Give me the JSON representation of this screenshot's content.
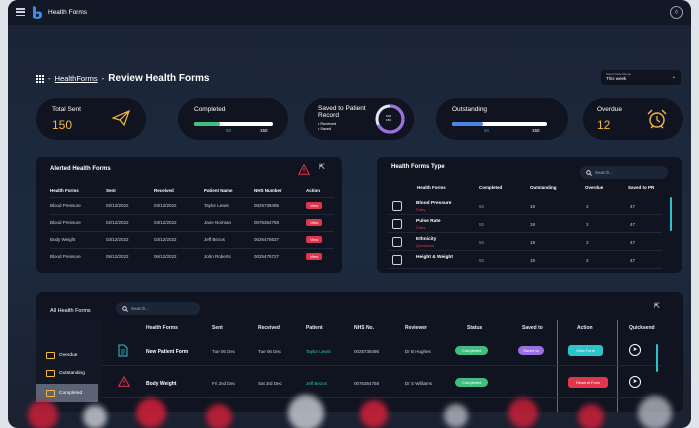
{
  "app": {
    "title": "Health Forms"
  },
  "breadcrumb": {
    "link": "HealthForms",
    "separator": "-",
    "title": "Review Health Forms"
  },
  "date_range": {
    "label": "Select Date Range",
    "value": "This week"
  },
  "stats": {
    "total_sent": {
      "label": "Total Sent",
      "value": "150"
    },
    "completed": {
      "label": "Completed",
      "done": "50",
      "total": "150",
      "fraction": 0.33
    },
    "saved": {
      "label_line1": "Saved to Patient",
      "label_line2": "Record",
      "legend": [
        "Received",
        "Saved"
      ],
      "ring_text_1": "100",
      "ring_text_2": "150"
    },
    "outstanding": {
      "label": "Outstanding",
      "done": "50",
      "total": "150",
      "fraction": 0.33
    },
    "overdue": {
      "label": "Overdue",
      "value": "12"
    }
  },
  "alerted": {
    "title": "Alerted Health Forms",
    "columns": [
      "Health Forms",
      "Sent",
      "Received",
      "Patient Name",
      "NHS Number",
      "Action"
    ],
    "rows": [
      [
        "Blood Pressure",
        "02/12/2022",
        "03/12/2022",
        "Taylor Lewis",
        "0025738495",
        "View"
      ],
      [
        "Blood Pressure",
        "02/12/2022",
        "03/12/2022",
        "Jane Norman",
        "0076364758",
        "View"
      ],
      [
        "Body Weight",
        "03/12/2022",
        "03/12/2022",
        "Jeff Bezos",
        "0026475637",
        "View"
      ],
      [
        "Blood Pressure",
        "05/12/2022",
        "06/12/2022",
        "John Roberts",
        "0025475727",
        "View"
      ]
    ]
  },
  "types": {
    "title": "Health Forms Type",
    "search_placeholder": "Search...",
    "columns": [
      "Health Forms",
      "Completed",
      "Outstanding",
      "Overdue",
      "Saved to PR"
    ],
    "rows": [
      {
        "name": "Blood Pressure",
        "sub": "Diary",
        "completed": "50",
        "outstanding": "19",
        "overdue": "3",
        "saved": "47"
      },
      {
        "name": "Pulse Rate",
        "sub": "Diary",
        "completed": "50",
        "outstanding": "19",
        "overdue": "3",
        "saved": "47"
      },
      {
        "name": "Ethnicity",
        "sub": "Questions",
        "completed": "50",
        "outstanding": "19",
        "overdue": "3",
        "saved": "47"
      },
      {
        "name": "Height & Weight",
        "sub": "",
        "completed": "50",
        "outstanding": "19",
        "overdue": "3",
        "saved": "47"
      }
    ]
  },
  "all_forms": {
    "title": "All Health Forms",
    "search_placeholder": "Search...",
    "nav": [
      "Overdue",
      "Outstanding",
      "Completed"
    ],
    "columns": [
      "Health Forms",
      "Sent",
      "Received",
      "Patient",
      "NHS No.",
      "Reviewer",
      "Status",
      "Saved to",
      "Action",
      "Quicksend"
    ],
    "rows": [
      {
        "form": "New Patient Form",
        "sent": "Tue 06 Dec",
        "received": "Tue 06 Dec",
        "patient": "Taylor Lewis",
        "nhs": "0025738495",
        "reviewer": "Dr B Hughes",
        "status": "Completed",
        "saved": "Saved to",
        "action": "View Form"
      },
      {
        "form": "Body Weight",
        "sent": "Fri 2nd Dec",
        "received": "Sat 3rd Dec",
        "patient": "Jeff Bezos",
        "nhs": "0076364758",
        "reviewer": "Dr S Williams",
        "status": "Completed",
        "saved": "",
        "action": "Resend Form"
      }
    ]
  },
  "colors": {
    "accent_yellow": "#f5b942",
    "accent_red": "#e0364c",
    "accent_green": "#3fbf7f",
    "accent_teal": "#2bc4c9",
    "accent_purple": "#9c6fe0",
    "accent_blue": "#4a86e8"
  }
}
